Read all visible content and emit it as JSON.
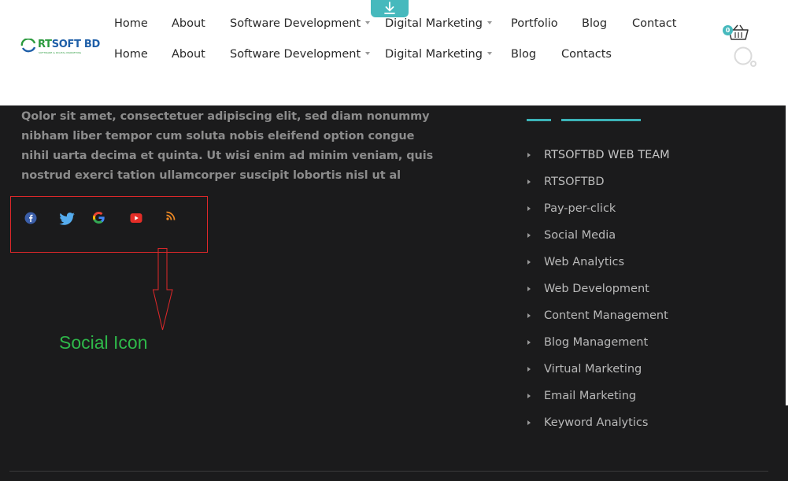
{
  "brand": {
    "logo_text_rt": "RT",
    "logo_text_rest": "SOFT BD",
    "tagline": "SOFTWARE & DIGITAL MARKETING"
  },
  "nav_primary": [
    {
      "label": "Home"
    },
    {
      "label": "About"
    },
    {
      "label": "Software Development",
      "has_dropdown": true
    },
    {
      "label": "Digital Marketing",
      "has_dropdown": true
    },
    {
      "label": "Portfolio"
    },
    {
      "label": "Blog"
    },
    {
      "label": "Contact"
    }
  ],
  "nav_secondary": [
    {
      "label": "Home"
    },
    {
      "label": "About"
    },
    {
      "label": "Software Development",
      "has_dropdown": true
    },
    {
      "label": "Digital Marketing",
      "has_dropdown": true
    },
    {
      "label": "Blog"
    },
    {
      "label": "Contacts"
    }
  ],
  "cart": {
    "count": "0"
  },
  "icons": {
    "download": "download-icon",
    "cart": "basket-icon",
    "search": "search-icon"
  },
  "footer": {
    "about_text": "Qolor sit amet, consectetuer adipiscing elit, sed diam nonummy nibham liber tempor cum soluta nobis eleifend option congue nihil uarta decima et quinta. Ut wisi enim ad minim veniam, quis nostrud exerci tation ullamcorper suscipit lobortis nisl ut al",
    "social_icons": [
      "facebook-icon",
      "twitter-icon",
      "google-icon",
      "youtube-icon",
      "rss-icon"
    ],
    "annotation_caption": "Social Icon",
    "links": [
      "RTSOFTBD WEB TEAM",
      "RTSOFTBD",
      "Pay-per-click",
      "Social Media",
      "Web Analytics",
      "Web Development",
      "Content Management",
      "Blog Management",
      "Virtual Marketing",
      "Email Marketing",
      "Keyword Analytics"
    ]
  },
  "colors": {
    "accent": "#46b9bd",
    "footer_bg": "#1b1b1c",
    "annotation_red": "#e0282a",
    "annotation_green": "#2fb84a",
    "logo_blue": "#1f5fa8",
    "logo_green": "#2b9a3e"
  }
}
